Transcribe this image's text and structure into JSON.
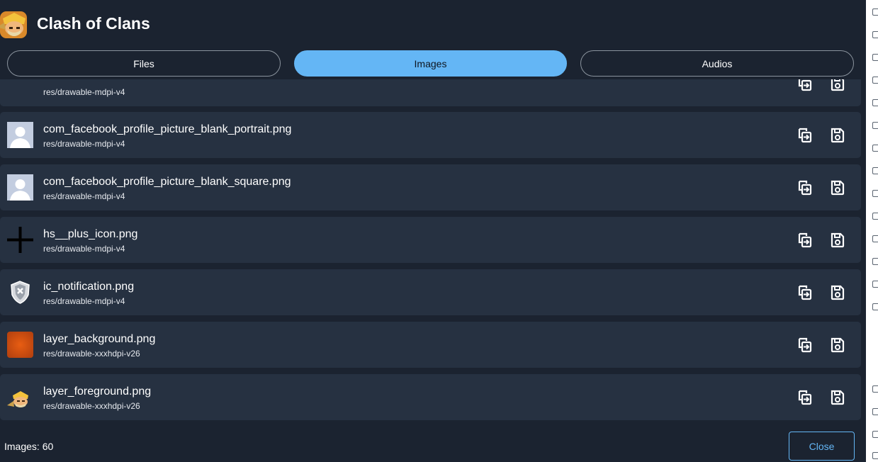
{
  "header": {
    "app_title": "Clash of Clans",
    "app_icon": "clash-of-clans-app-icon"
  },
  "tabs": [
    {
      "label": "Files",
      "active": false
    },
    {
      "label": "Images",
      "active": true
    },
    {
      "label": "Audios",
      "active": false
    }
  ],
  "list": {
    "partial_top_row": {
      "path": "res/drawable-mdpi-v4"
    },
    "rows": [
      {
        "name": "com_facebook_profile_picture_blank_portrait.png",
        "path": "res/drawable-mdpi-v4",
        "thumb": "profile-silhouette-icon"
      },
      {
        "name": "com_facebook_profile_picture_blank_square.png",
        "path": "res/drawable-mdpi-v4",
        "thumb": "profile-silhouette-icon"
      },
      {
        "name": "hs__plus_icon.png",
        "path": "res/drawable-mdpi-v4",
        "thumb": "plus-icon"
      },
      {
        "name": "ic_notification.png",
        "path": "res/drawable-mdpi-v4",
        "thumb": "notification-shield-icon"
      },
      {
        "name": "layer_background.png",
        "path": "res/drawable-xxxhdpi-v26",
        "thumb": "orange-blur-image"
      },
      {
        "name": "layer_foreground.png",
        "path": "res/drawable-xxxhdpi-v26",
        "thumb": "barbarian-icon"
      }
    ],
    "actions": {
      "copy_icon": "copy-to-icon",
      "save_icon": "save-icon"
    }
  },
  "footer": {
    "count_text": "Images: 60",
    "close_label": "Close"
  },
  "colors": {
    "background": "#1b2330",
    "row": "#263141",
    "accent": "#64b6f5"
  }
}
